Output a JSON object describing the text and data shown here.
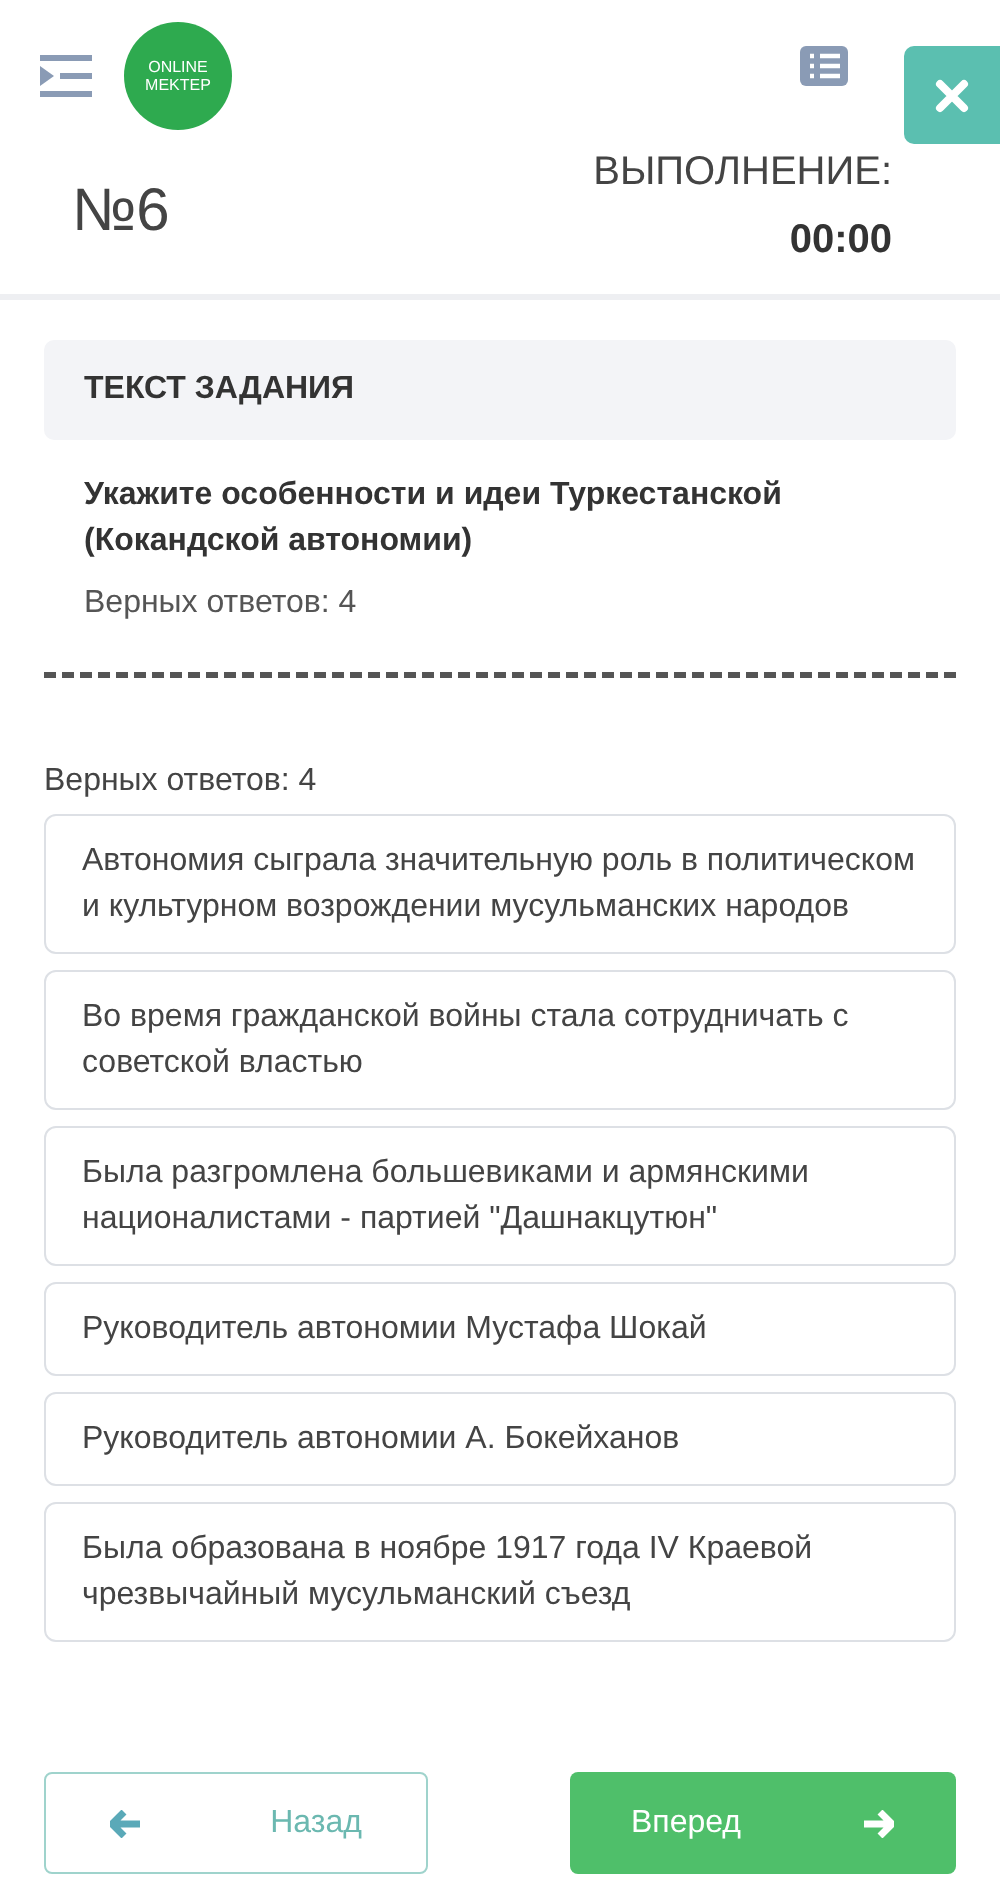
{
  "header": {
    "logo": [
      "ONLINE",
      "MEKTEP"
    ]
  },
  "task": {
    "number": "№6",
    "timer_label": "ВЫПОЛНЕНИЕ:",
    "timer": "00:00"
  },
  "task_text": {
    "heading": "ТЕКСТ ЗАДАНИЯ",
    "question": "Укажите особенности и идеи Туркестанской (Кокандской автономии)",
    "correct_count": "Верных ответов: 4"
  },
  "answers_label": "Верных ответов: 4",
  "answers": [
    {
      "text": "Автономия сыграла значительную роль в политическом и культурном возрождении мусульманских народов"
    },
    {
      "text": "Во время гражданской войны стала сотрудничать с советской властью"
    },
    {
      "text": "Была разгромлена большевиками и армянскими националистами - партией \"Дашнакцутюн\""
    },
    {
      "text": "Руководитель автономии Мустафа Шокай"
    },
    {
      "text": "Руководитель автономии А. Бокейханов"
    },
    {
      "text": "Была образована в ноябре 1917 года IV Краевой чрезвычайный мусульманский съезд"
    }
  ],
  "nav": {
    "back": "Назад",
    "next": "Вперед"
  }
}
